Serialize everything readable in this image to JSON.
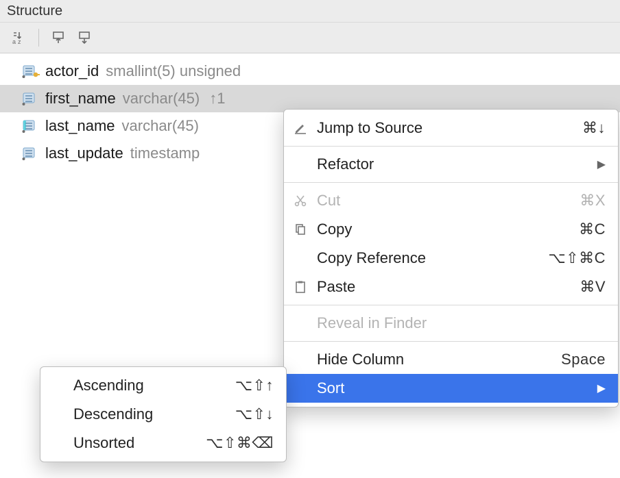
{
  "header": {
    "title": "Structure"
  },
  "columns": [
    {
      "name": "actor_id",
      "type": "smallint(5) unsigned",
      "sort": "",
      "kind": "pk"
    },
    {
      "name": "first_name",
      "type": "varchar(45)",
      "sort": "↑1",
      "kind": "col",
      "selected": true
    },
    {
      "name": "last_name",
      "type": "varchar(45)",
      "sort": "",
      "kind": "idx"
    },
    {
      "name": "last_update",
      "type": "timestamp",
      "sort": "",
      "kind": "col"
    }
  ],
  "menu": {
    "jump": {
      "label": "Jump to Source",
      "shortcut": "⌘↓"
    },
    "refactor": {
      "label": "Refactor"
    },
    "cut": {
      "label": "Cut",
      "shortcut": "⌘X"
    },
    "copy": {
      "label": "Copy",
      "shortcut": "⌘C"
    },
    "copyref": {
      "label": "Copy Reference",
      "shortcut": "⌥⇧⌘C"
    },
    "paste": {
      "label": "Paste",
      "shortcut": "⌘V"
    },
    "reveal": {
      "label": "Reveal in Finder"
    },
    "hide": {
      "label": "Hide Column",
      "shortcut": "Space"
    },
    "sort": {
      "label": "Sort"
    }
  },
  "sortmenu": {
    "asc": {
      "label": "Ascending",
      "shortcut": "⌥⇧↑"
    },
    "desc": {
      "label": "Descending",
      "shortcut": "⌥⇧↓"
    },
    "none": {
      "label": "Unsorted",
      "shortcut": "⌥⇧⌘⌫"
    }
  }
}
